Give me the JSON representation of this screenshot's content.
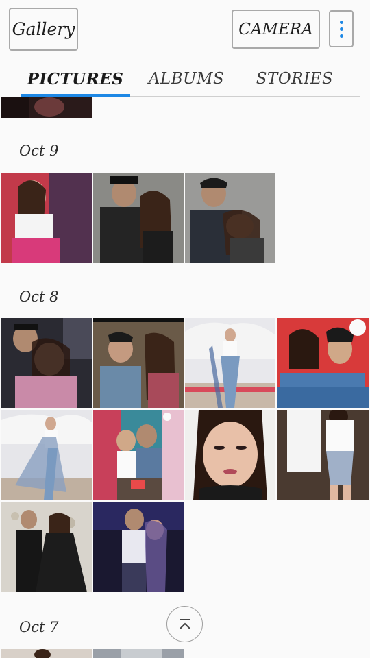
{
  "header": {
    "gallery_label": "Gallery",
    "camera_label": "CAMERA",
    "more_icon": "more-vertical-icon",
    "accent_color": "#1e88e5"
  },
  "tabs": [
    {
      "label": "PICTURES",
      "active": true
    },
    {
      "label": "ALBUMS",
      "active": false
    },
    {
      "label": "STORIES",
      "active": false
    }
  ],
  "sections": [
    {
      "date": "Oct 9",
      "photo_count": 3
    },
    {
      "date": "Oct 8",
      "photo_count": 10
    },
    {
      "date": "Oct 7",
      "photo_count": 2
    }
  ],
  "scroll_top": {
    "icon": "scroll-to-top-icon"
  }
}
